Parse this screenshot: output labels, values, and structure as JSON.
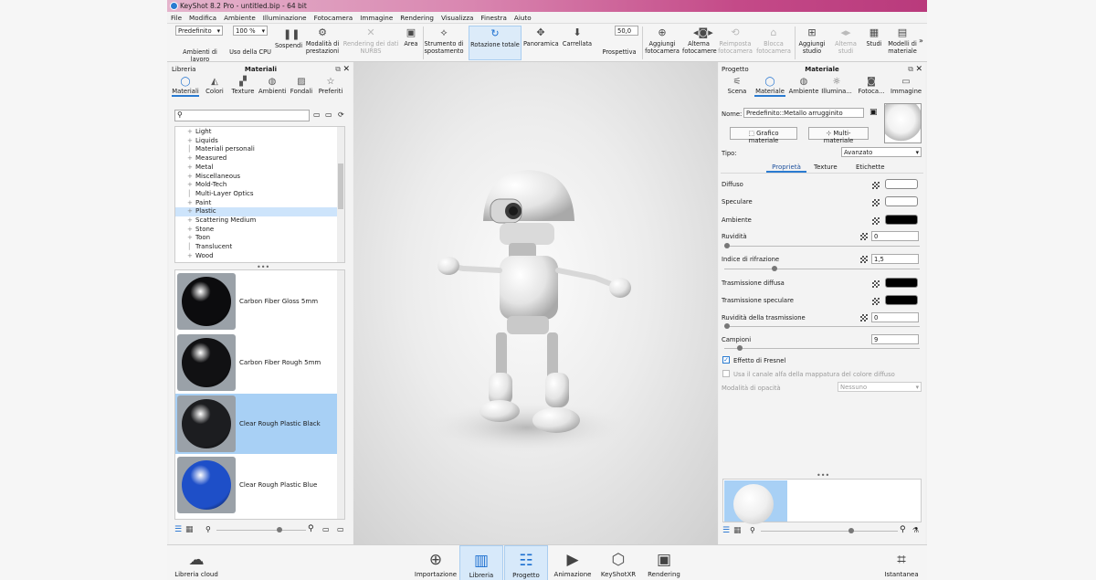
{
  "window": {
    "title": "KeyShot 8.2 Pro - untitled.bip - 64 bit"
  },
  "menu": [
    "File",
    "Modifica",
    "Ambiente",
    "Illuminazione",
    "Fotocamera",
    "Immagine",
    "Rendering",
    "Visualizza",
    "Finestra",
    "Aiuto"
  ],
  "toolbar": {
    "env_select": "Predefinito",
    "cpu_select": "100 %",
    "fov_value": "50,0",
    "items": [
      {
        "label": "Ambienti di lavoro",
        "icon": "workspace-icon"
      },
      {
        "label": "Uso della CPU",
        "icon": "cpu-icon"
      },
      {
        "label": "Sospendi",
        "icon": "pause-icon"
      },
      {
        "label": "Modalità di prestazioni",
        "icon": "performance-icon"
      },
      {
        "label": "Rendering dei dati NURBS",
        "icon": "nurbs-icon",
        "disabled": true
      },
      {
        "label": "Area",
        "icon": "area-icon"
      },
      {
        "label": "Strumento di spostamento",
        "icon": "move-icon"
      },
      {
        "label": "Rotazione totale",
        "icon": "tumble-icon",
        "active": true
      },
      {
        "label": "Panoramica",
        "icon": "pan-icon"
      },
      {
        "label": "Carrellata",
        "icon": "dolly-icon"
      },
      {
        "label": "Prospettiva",
        "icon": "perspective-icon"
      },
      {
        "label": "Aggiungi fotocamera",
        "icon": "add-camera-icon"
      },
      {
        "label": "Alterna fotocamere",
        "icon": "switch-camera-icon"
      },
      {
        "label": "Reimposta fotocamera",
        "icon": "reset-camera-icon",
        "disabled": true
      },
      {
        "label": "Blocca fotocamera",
        "icon": "lock-camera-icon",
        "disabled": true
      },
      {
        "label": "Aggiungi studio",
        "icon": "add-studio-icon"
      },
      {
        "label": "Alterna studi",
        "icon": "switch-studio-icon",
        "disabled": true
      },
      {
        "label": "Studi",
        "icon": "studios-icon"
      },
      {
        "label": "Modelli di materiale",
        "icon": "material-templates-icon"
      }
    ]
  },
  "library": {
    "left_title": "Libreria",
    "center_title": "Materiali",
    "tabs": [
      "Materiali",
      "Colori",
      "Texture",
      "Ambienti",
      "Fondali",
      "Preferiti"
    ],
    "tree": [
      {
        "label": "Light",
        "plus": true
      },
      {
        "label": "Liquids",
        "plus": true
      },
      {
        "label": "Materiali personali",
        "plus": false
      },
      {
        "label": "Measured",
        "plus": true
      },
      {
        "label": "Metal",
        "plus": true
      },
      {
        "label": "Miscellaneous",
        "plus": true
      },
      {
        "label": "Mold-Tech",
        "plus": true
      },
      {
        "label": "Multi-Layer Optics",
        "plus": false
      },
      {
        "label": "Paint",
        "plus": true
      },
      {
        "label": "Plastic",
        "plus": true,
        "selected": true
      },
      {
        "label": "Scattering Medium",
        "plus": true
      },
      {
        "label": "Stone",
        "plus": true
      },
      {
        "label": "Toon",
        "plus": true
      },
      {
        "label": "Translucent",
        "plus": false
      },
      {
        "label": "Wood",
        "plus": true
      }
    ],
    "thumbs": [
      {
        "label": "Carbon Fiber Gloss 5mm",
        "color": "#0c0c0e"
      },
      {
        "label": "Carbon Fiber Rough 5mm",
        "color": "#111113"
      },
      {
        "label": "Clear Rough Plastic Black",
        "color": "#1c1d20",
        "selected": true
      },
      {
        "label": "Clear Rough Plastic Blue",
        "color": "#1e4fc8"
      }
    ]
  },
  "project": {
    "left_title": "Progetto",
    "center_title": "Materiale",
    "tabs": [
      "Scena",
      "Materiale",
      "Ambiente",
      "Illumina...",
      "Fotoca...",
      "Immagine"
    ],
    "name_label": "Nome:",
    "name_value": "Predefinito::Metallo arrugginito",
    "graph_button": "Grafico materiale",
    "multi_button": "Multi-materiale",
    "type_label": "Tipo:",
    "type_value": "Avanzato",
    "subtabs": [
      "Proprietà",
      "Texture",
      "Etichette"
    ],
    "props": {
      "diffuse": "Diffuso",
      "specular": "Speculare",
      "ambient": "Ambiente",
      "roughness": "Ruvidità",
      "roughness_value": "0",
      "ior": "Indice di rifrazione",
      "ior_value": "1,5",
      "diff_trans": "Trasmissione diffusa",
      "spec_trans": "Trasmissione speculare",
      "trans_rough": "Ruvidità della trasmissione",
      "trans_rough_value": "0",
      "samples": "Campioni",
      "samples_value": "9",
      "fresnel": "Effetto di Fresnel",
      "alpha": "Usa il canale alfa della mappatura del colore diffuso",
      "opacity": "Modalità di opacità",
      "opacity_value": "Nessuno"
    },
    "colors": {
      "diffuse": "#ffffff",
      "specular": "#ffffff",
      "ambient": "#000000",
      "diff_trans": "#000000",
      "spec_trans": "#000000"
    }
  },
  "bottom": [
    {
      "label": "Libreria cloud",
      "icon": "cloud-library-icon"
    },
    {
      "label": "Importazione",
      "icon": "import-icon"
    },
    {
      "label": "Libreria",
      "icon": "library-icon",
      "active": true
    },
    {
      "label": "Progetto",
      "icon": "project-icon",
      "active": true
    },
    {
      "label": "Animazione",
      "icon": "animation-icon"
    },
    {
      "label": "KeyShotXR",
      "icon": "keyshotxr-icon"
    },
    {
      "label": "Rendering",
      "icon": "render-icon"
    },
    {
      "label": "Istantanea",
      "icon": "screenshot-icon"
    }
  ]
}
